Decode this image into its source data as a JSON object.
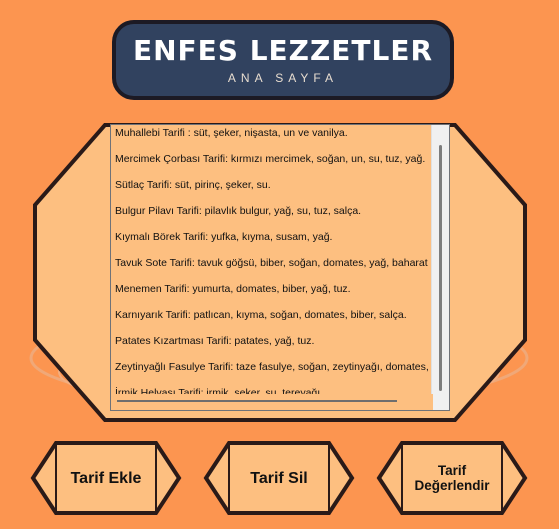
{
  "header": {
    "title": "ENFES LEZZETLER",
    "subtitle": "ANA SAYFA"
  },
  "recipes": [
    "Muhallebi Tarifi : süt, şeker, nişasta, un ve vanilya.",
    "Mercimek Çorbası Tarifi: kırmızı mercimek, soğan, un, su, tuz, yağ.",
    "Sütlaç Tarifi: süt, pirinç, şeker, su.",
    "Bulgur Pilavı Tarifi: pilavlık bulgur, yağ, su, tuz, salça.",
    "Kıymalı Börek Tarifi: yufka, kıyma, susam, yağ.",
    "Tavuk Sote Tarifi: tavuk göğsü, biber, soğan, domates, yağ, baharat",
    "Menemen Tarifi: yumurta, domates, biber, yağ, tuz.",
    "Karnıyarık Tarifi: patlıcan, kıyma, soğan, domates, biber, salça.",
    "Patates Kızartması Tarifi: patates, yağ, tuz.",
    "Zeytinyağlı Fasulye Tarifi: taze fasulye, soğan, zeytinyağı, domates, t",
    "İrmik Helvası Tarifi: irmik, şeker, su, tereyağı."
  ],
  "buttons": {
    "add": "Tarif Ekle",
    "delete": "Tarif Sil",
    "rate_line1": "Tarif",
    "rate_line2": "Değerlendir"
  },
  "colors": {
    "background": "#fc9550",
    "panel": "#fdbf80",
    "banner": "#31425f",
    "outline": "#2a1a18"
  }
}
